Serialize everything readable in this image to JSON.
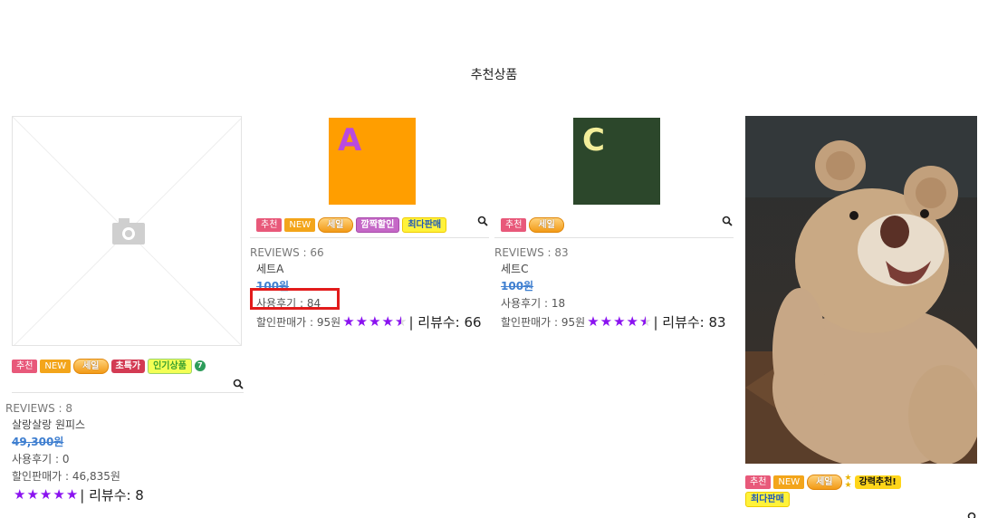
{
  "section": {
    "title": "추천상품"
  },
  "products": [
    {
      "badges": {
        "rec": "추천",
        "new": "NEW",
        "sale": "세일",
        "special": "초특가",
        "popular": "인기상품",
        "count": "7"
      },
      "reviews_label": "REVIEWS : 8",
      "name": "살랑살랑 원피스",
      "original_price": "49,300원",
      "review_count_line": "사용후기 : 0",
      "sale_price_line": "할인판매가 : 46,835원",
      "rating": 5,
      "review_suffix": "| 리뷰수: 8"
    },
    {
      "thumb_letter": "A",
      "thumb_bg": "#ff9e00",
      "thumb_fg": "#b94adf",
      "badges": {
        "rec": "추천",
        "new": "NEW",
        "sale": "세일",
        "flash": "깜짝할인",
        "best": "최다판매"
      },
      "reviews_label": "REVIEWS : 66",
      "name": "세트A",
      "original_price": "100원",
      "review_count_line": "사용후기 : 84",
      "sale_price_line": "할인판매가 : 95원",
      "rating": 4.5,
      "review_suffix": "| 리뷰수: 66"
    },
    {
      "thumb_letter": "C",
      "thumb_bg": "#2c472b",
      "thumb_fg": "#f3ee9a",
      "badges": {
        "rec": "추천",
        "sale": "세일"
      },
      "reviews_label": "REVIEWS : 83",
      "name": "세트C",
      "original_price": "100원",
      "review_count_line": "사용후기 : 18",
      "sale_price_line": "할인판매가 : 95원",
      "rating": 4.5,
      "review_suffix": "| 리뷰수: 83"
    },
    {
      "badges": {
        "rec": "추천",
        "new": "NEW",
        "sale": "세일",
        "strong": "강력추천!",
        "best": "최다판매"
      }
    }
  ],
  "colors": {
    "accent_star": "#8a12f0",
    "highlight": "#e21b1b",
    "strikethrough_price": "#3f7fd0"
  },
  "icons": {
    "search": "search-icon",
    "camera": "camera-icon"
  }
}
